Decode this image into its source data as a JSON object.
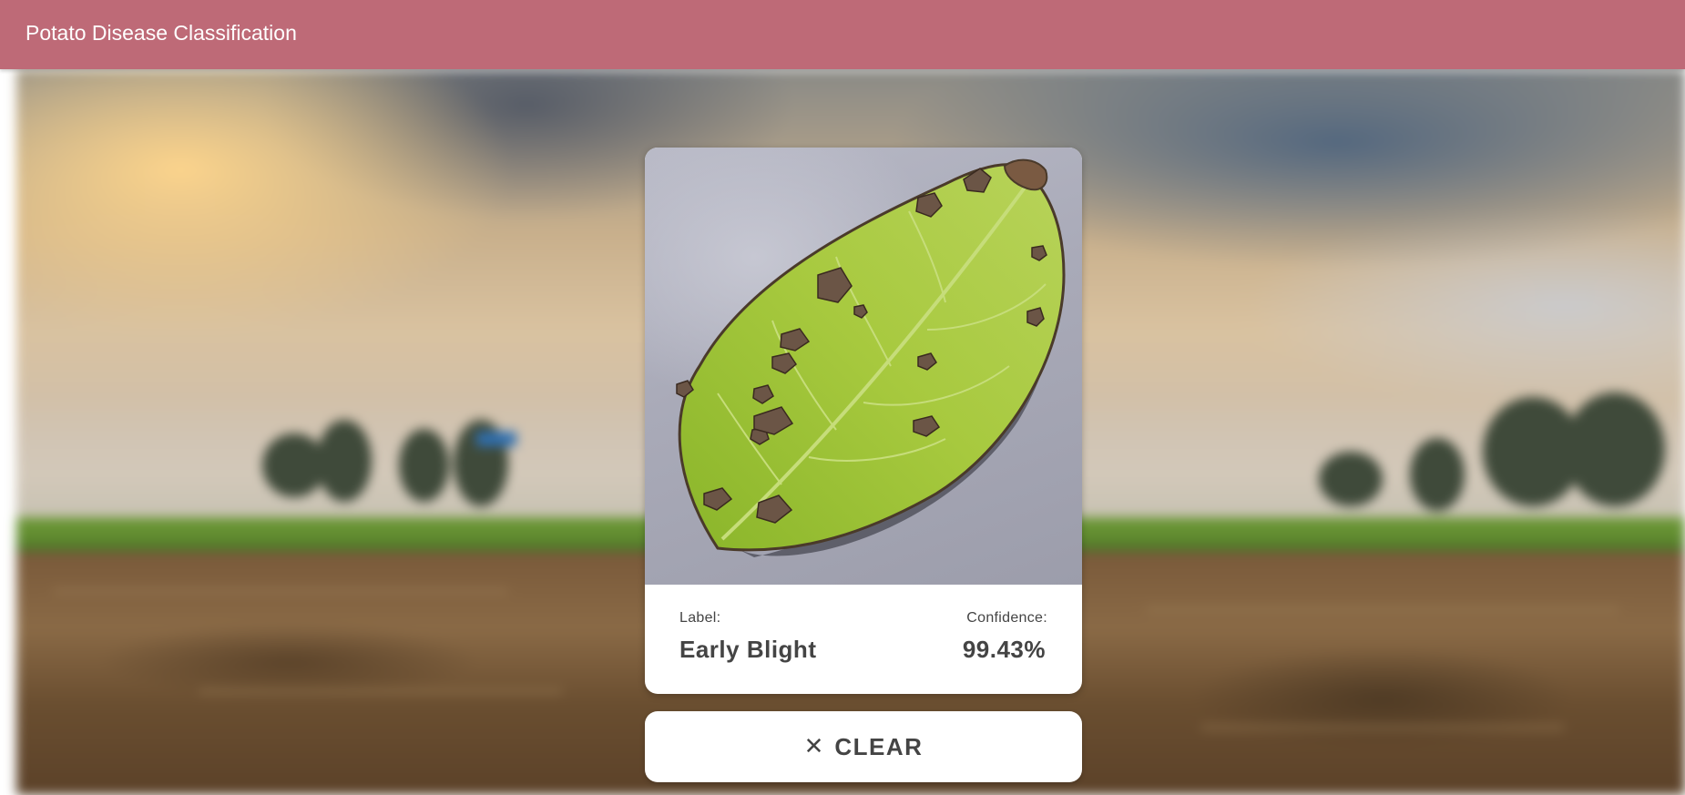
{
  "appbar": {
    "title": "Potato Disease Classification",
    "color": "#be6a77"
  },
  "result_card": {
    "image_alt": "potato leaf",
    "label_title": "Label:",
    "label_value": "Early Blight",
    "confidence_title": "Confidence:",
    "confidence_value": "99.43%"
  },
  "clear_button": {
    "icon": "close-icon",
    "label": "CLEAR"
  }
}
